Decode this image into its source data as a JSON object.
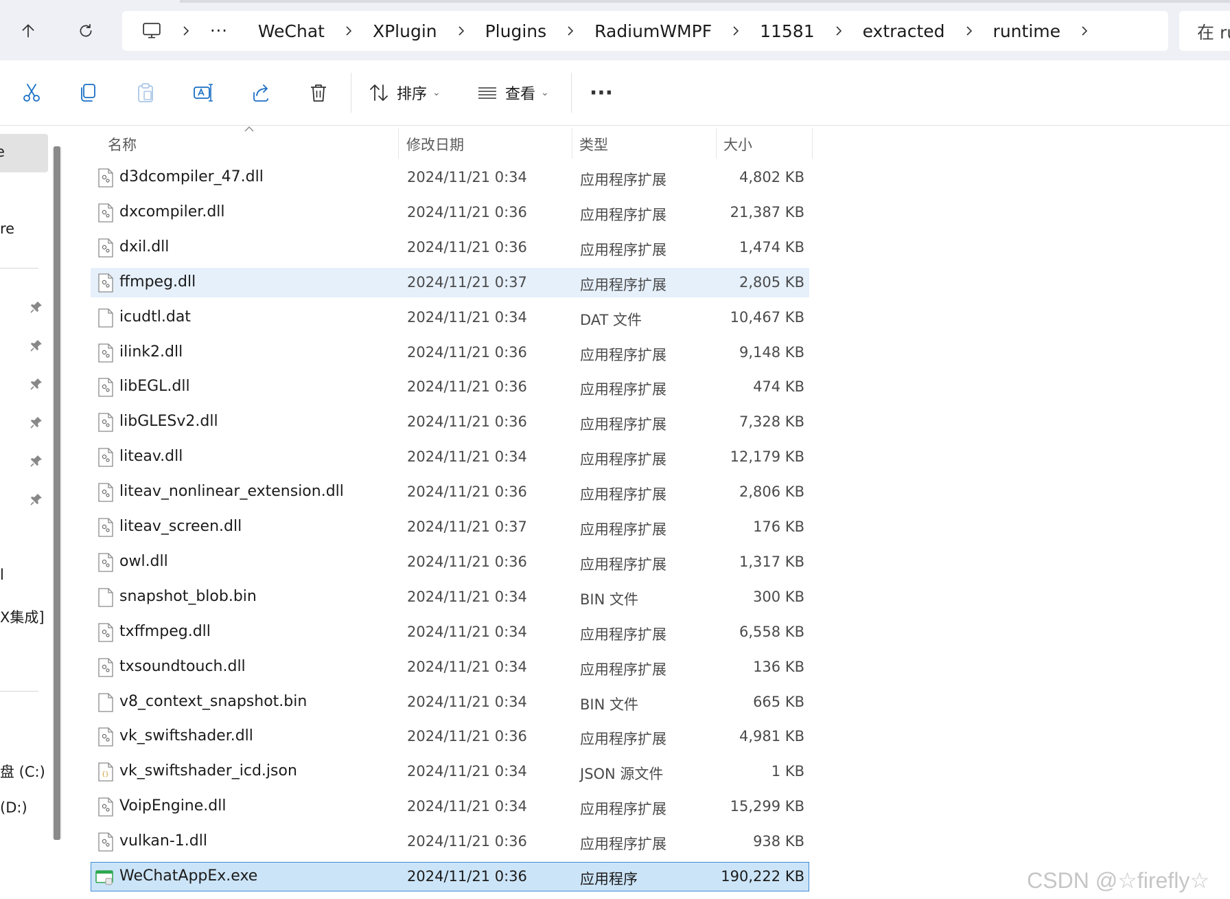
{
  "breadcrumb": {
    "overflow": "···",
    "items": [
      "WeChat",
      "XPlugin",
      "Plugins",
      "RadiumWMPF",
      "11581",
      "extracted",
      "runtime"
    ]
  },
  "search": {
    "placeholder": "在 ru"
  },
  "toolbar": {
    "sort_label": "排序",
    "view_label": "查看",
    "more_label": "···"
  },
  "nav": {
    "fragments": [
      "e",
      "re",
      "l",
      "X集成]",
      "盘 (C:)",
      "(D:)"
    ]
  },
  "columns": {
    "name": "名称",
    "date": "修改日期",
    "type": "类型",
    "size": "大小"
  },
  "files": [
    {
      "name": "d3dcompiler_47.dll",
      "date": "2024/11/21 0:34",
      "type": "应用程序扩展",
      "size": "4,802 KB",
      "icon": "dll-icon"
    },
    {
      "name": "dxcompiler.dll",
      "date": "2024/11/21 0:36",
      "type": "应用程序扩展",
      "size": "21,387 KB",
      "icon": "dll-icon"
    },
    {
      "name": "dxil.dll",
      "date": "2024/11/21 0:36",
      "type": "应用程序扩展",
      "size": "1,474 KB",
      "icon": "dll-icon"
    },
    {
      "name": "ffmpeg.dll",
      "date": "2024/11/21 0:37",
      "type": "应用程序扩展",
      "size": "2,805 KB",
      "icon": "dll-icon"
    },
    {
      "name": "icudtl.dat",
      "date": "2024/11/21 0:34",
      "type": "DAT 文件",
      "size": "10,467 KB",
      "icon": "blank-file-icon"
    },
    {
      "name": "ilink2.dll",
      "date": "2024/11/21 0:36",
      "type": "应用程序扩展",
      "size": "9,148 KB",
      "icon": "dll-icon"
    },
    {
      "name": "libEGL.dll",
      "date": "2024/11/21 0:36",
      "type": "应用程序扩展",
      "size": "474 KB",
      "icon": "dll-icon"
    },
    {
      "name": "libGLESv2.dll",
      "date": "2024/11/21 0:36",
      "type": "应用程序扩展",
      "size": "7,328 KB",
      "icon": "dll-icon"
    },
    {
      "name": "liteav.dll",
      "date": "2024/11/21 0:34",
      "type": "应用程序扩展",
      "size": "12,179 KB",
      "icon": "dll-icon"
    },
    {
      "name": "liteav_nonlinear_extension.dll",
      "date": "2024/11/21 0:36",
      "type": "应用程序扩展",
      "size": "2,806 KB",
      "icon": "dll-icon"
    },
    {
      "name": "liteav_screen.dll",
      "date": "2024/11/21 0:37",
      "type": "应用程序扩展",
      "size": "176 KB",
      "icon": "dll-icon"
    },
    {
      "name": "owl.dll",
      "date": "2024/11/21 0:36",
      "type": "应用程序扩展",
      "size": "1,317 KB",
      "icon": "dll-icon"
    },
    {
      "name": "snapshot_blob.bin",
      "date": "2024/11/21 0:34",
      "type": "BIN 文件",
      "size": "300 KB",
      "icon": "blank-file-icon"
    },
    {
      "name": "txffmpeg.dll",
      "date": "2024/11/21 0:34",
      "type": "应用程序扩展",
      "size": "6,558 KB",
      "icon": "dll-icon"
    },
    {
      "name": "txsoundtouch.dll",
      "date": "2024/11/21 0:34",
      "type": "应用程序扩展",
      "size": "136 KB",
      "icon": "dll-icon"
    },
    {
      "name": "v8_context_snapshot.bin",
      "date": "2024/11/21 0:34",
      "type": "BIN 文件",
      "size": "665 KB",
      "icon": "blank-file-icon"
    },
    {
      "name": "vk_swiftshader.dll",
      "date": "2024/11/21 0:36",
      "type": "应用程序扩展",
      "size": "4,981 KB",
      "icon": "dll-icon"
    },
    {
      "name": "vk_swiftshader_icd.json",
      "date": "2024/11/21 0:34",
      "type": "JSON 源文件",
      "size": "1 KB",
      "icon": "json-file-icon"
    },
    {
      "name": "VoipEngine.dll",
      "date": "2024/11/21 0:34",
      "type": "应用程序扩展",
      "size": "15,299 KB",
      "icon": "dll-icon"
    },
    {
      "name": "vulkan-1.dll",
      "date": "2024/11/21 0:36",
      "type": "应用程序扩展",
      "size": "938 KB",
      "icon": "dll-icon"
    },
    {
      "name": "WeChatAppEx.exe",
      "date": "2024/11/21 0:36",
      "type": "应用程序",
      "size": "190,222 KB",
      "icon": "exe-icon"
    }
  ],
  "state": {
    "hovered_file": "ffmpeg.dll",
    "selected_file": "WeChatAppEx.exe"
  },
  "watermark": "CSDN @☆firefly☆",
  "colors": {
    "selected_bg": "#cce4f7",
    "selected_border": "#3d8bd6",
    "hover_bg": "#e6f0fb",
    "accent": "#1a6fc4"
  }
}
